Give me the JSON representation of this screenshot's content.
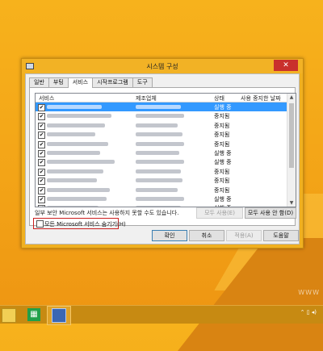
{
  "window": {
    "title": "시스템 구성",
    "close_label": "✕"
  },
  "tabs": [
    {
      "label": "일반"
    },
    {
      "label": "부팅"
    },
    {
      "label": "서비스",
      "active": true
    },
    {
      "label": "시작프로그램"
    },
    {
      "label": "도구"
    }
  ],
  "services_list": {
    "columns": {
      "service": "서비스",
      "manufacturer": "제조업체",
      "status": "상태",
      "disabled_date": "사용 중지한 날짜"
    },
    "rows": [
      {
        "checked": true,
        "status": "실행 중",
        "selected": true
      },
      {
        "checked": true,
        "status": "중지됨"
      },
      {
        "checked": true,
        "status": "중지됨"
      },
      {
        "checked": true,
        "status": "중지됨"
      },
      {
        "checked": true,
        "status": "중지됨"
      },
      {
        "checked": true,
        "status": "실행 중"
      },
      {
        "checked": true,
        "status": "실행 중"
      },
      {
        "checked": true,
        "status": "중지됨"
      },
      {
        "checked": true,
        "status": "중지됨"
      },
      {
        "checked": true,
        "status": "중지됨"
      },
      {
        "checked": true,
        "status": "실행 중"
      },
      {
        "checked": true,
        "status": "실행 중"
      }
    ]
  },
  "note": "일부 보안 Microsoft 서비스는 사용하지 못할 수도 있습니다.",
  "enable_all_label": "모두 사용(E)",
  "disable_all_label": "모두 사용 안 함(D)",
  "hide_ms_label": "모든 Microsoft 서비스 숨기기(H)",
  "hide_ms_checked": false,
  "dialog_buttons": {
    "ok": "확인",
    "cancel": "취소",
    "apply": "적용(A)",
    "help": "도움말"
  },
  "watermark": "WWW"
}
